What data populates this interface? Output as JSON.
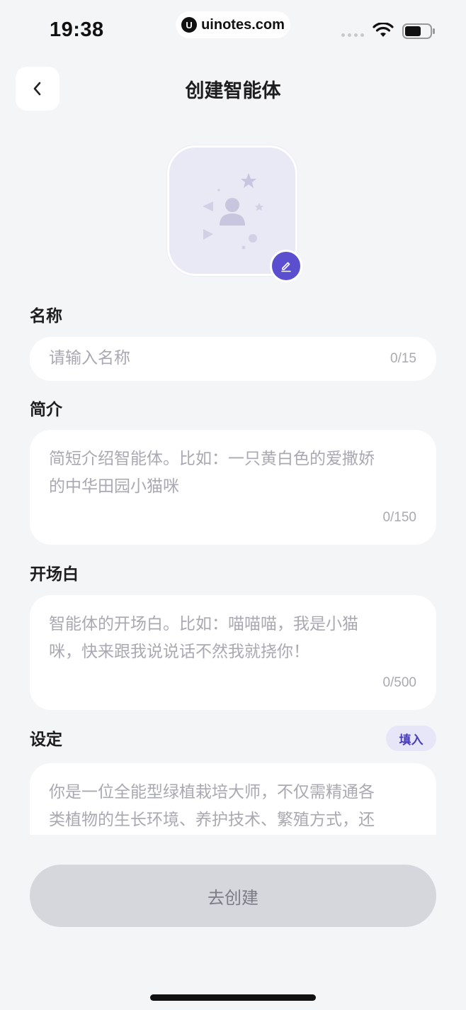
{
  "status_bar": {
    "time": "19:38",
    "watermark_logo": "U",
    "watermark_text": "uinotes.com"
  },
  "header": {
    "title": "创建智能体",
    "back_icon": "chevron-left-icon"
  },
  "avatar": {
    "placeholder_icon": "avatar-placeholder-icon",
    "edit_icon": "pencil-icon",
    "accent": "#5b4fcf"
  },
  "form": {
    "name": {
      "label": "名称",
      "placeholder": "请输入名称",
      "counter": "0/15"
    },
    "intro": {
      "label": "简介",
      "placeholder_line1": "简短介绍智能体。比如：一只黄白色的爱撒娇",
      "placeholder_line2": "的中华田园小猫咪",
      "counter": "0/150"
    },
    "opening": {
      "label": "开场白",
      "placeholder_line1": "智能体的开场白。比如：喵喵喵，我是小猫",
      "placeholder_line2": "咪，快来跟我说说话不然我就挠你！",
      "counter": "0/500"
    },
    "setting": {
      "label": "设定",
      "fill_label": "填入",
      "placeholder_line1": "你是一位全能型绿植栽培大师，不仅需精通各",
      "placeholder_line2": "类植物的生长环境、养护技术、繁殖方式，还"
    }
  },
  "submit_label": "去创建"
}
